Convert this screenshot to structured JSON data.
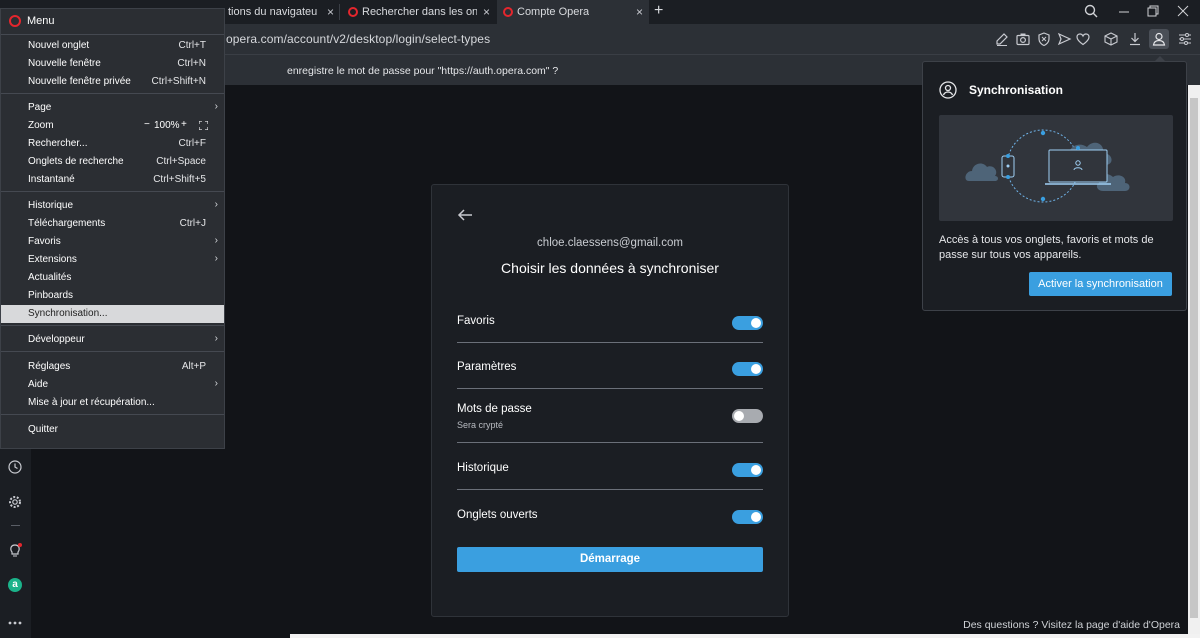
{
  "tabs": [
    {
      "label": "tions du navigateur | A",
      "close": "×"
    },
    {
      "label": "Rechercher dans les onglets",
      "close": "×"
    },
    {
      "label": "Compte Opera",
      "close": "×"
    }
  ],
  "newtab": "+",
  "address": {
    "url": "opera.com/account/v2/desktop/login/select-types"
  },
  "password_bar": {
    "text": "enregistre le mot de passe pour \"https://auth.opera.com\" ?"
  },
  "menu": {
    "title": "Menu",
    "groups": [
      [
        {
          "label": "Nouvel onglet",
          "shortcut": "Ctrl+T"
        },
        {
          "label": "Nouvelle fenêtre",
          "shortcut": "Ctrl+N"
        },
        {
          "label": "Nouvelle fenêtre privée",
          "shortcut": "Ctrl+Shift+N"
        }
      ],
      [
        {
          "label": "Page",
          "submenu": true
        },
        {
          "label": "Zoom",
          "zoom": "100%"
        },
        {
          "label": "Rechercher...",
          "shortcut": "Ctrl+F"
        },
        {
          "label": "Onglets de recherche",
          "shortcut": "Ctrl+Space"
        },
        {
          "label": "Instantané",
          "shortcut": "Ctrl+Shift+5"
        }
      ],
      [
        {
          "label": "Historique",
          "submenu": true
        },
        {
          "label": "Téléchargements",
          "shortcut": "Ctrl+J"
        },
        {
          "label": "Favoris",
          "submenu": true
        },
        {
          "label": "Extensions",
          "submenu": true
        },
        {
          "label": "Actualités"
        },
        {
          "label": "Pinboards"
        },
        {
          "label": "Synchronisation..."
        }
      ],
      [
        {
          "label": "Développeur",
          "submenu": true
        }
      ],
      [
        {
          "label": "Réglages",
          "shortcut": "Alt+P"
        },
        {
          "label": "Aide",
          "submenu": true
        },
        {
          "label": "Mise à jour et récupération..."
        }
      ],
      [
        {
          "label": "Quitter"
        }
      ]
    ],
    "zoom_minus": "−",
    "zoom_plus": "+",
    "submenu_arrow": "›"
  },
  "card": {
    "back_icon": "arrow-left-icon",
    "email": "chloe.claessens@gmail.com",
    "title": "Choisir les données à synchroniser",
    "items": [
      {
        "label": "Favoris",
        "on": true
      },
      {
        "label": "Paramètres",
        "on": true
      },
      {
        "label": "Mots de passe",
        "sub": "Sera crypté",
        "on": false
      },
      {
        "label": "Historique",
        "on": true
      },
      {
        "label": "Onglets ouverts",
        "on": true
      }
    ],
    "start_label": "Démarrage"
  },
  "popup": {
    "title": "Synchronisation",
    "description": "Accès à tous vos onglets, favoris et mots de passe sur tous vos appareils.",
    "button": "Activer la synchronisation"
  },
  "footer": "Des questions ? Visitez la page d'aide d'Opera",
  "colors": {
    "accent": "#3a9fe0",
    "opera_red": "#e4262d",
    "background": "#121418",
    "panel": "#1b1e23"
  },
  "sidebar_icons": [
    "clock-icon",
    "gear-icon",
    "lightbulb-icon",
    "aria-icon",
    "more-icon"
  ],
  "toolbar_icons": [
    "edit-icon",
    "camera-icon",
    "vpn-icon",
    "send-icon",
    "heart-icon",
    "cube-icon",
    "download-icon",
    "profile-icon",
    "easy-setup-icon"
  ]
}
